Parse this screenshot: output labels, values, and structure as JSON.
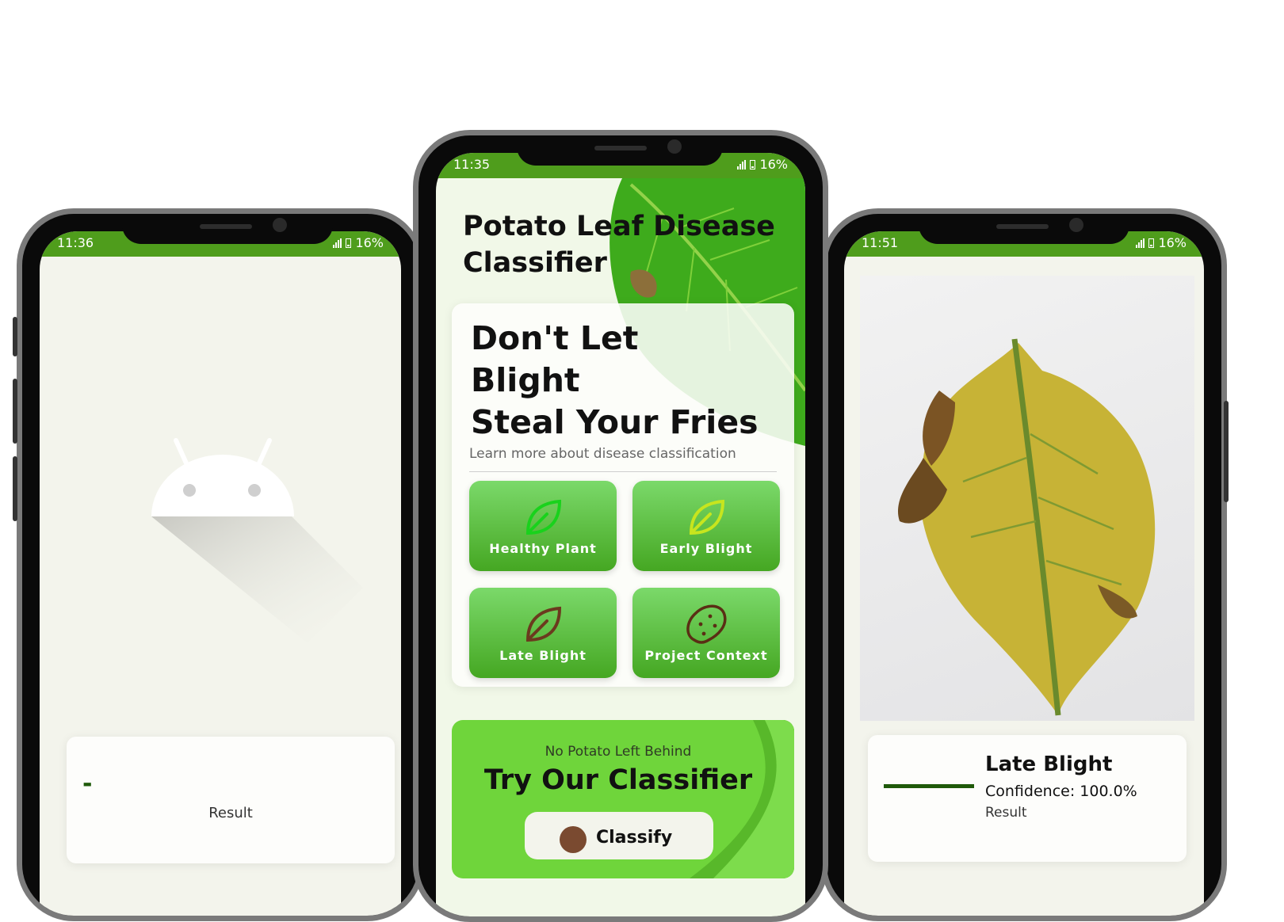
{
  "left_phone": {
    "status": {
      "time": "11:36",
      "battery": "16%"
    },
    "result_card": {
      "dash": "-",
      "result_label": "Result"
    }
  },
  "center_phone": {
    "status": {
      "time": "11:35",
      "battery": "16%"
    },
    "app_title_line1": "Potato Leaf Disease",
    "app_title_line2": "Classifier",
    "hero": {
      "line1": "Don't Let",
      "line2": "Blight",
      "line3": "Steal Your Fries",
      "link": "Learn more about disease classification"
    },
    "tiles": [
      {
        "label": "Healthy Plant",
        "icon": "leaf-icon",
        "color": "#19d21c"
      },
      {
        "label": "Early Blight",
        "icon": "leaf-icon",
        "color": "#c7e51e"
      },
      {
        "label": "Late Blight",
        "icon": "leaf-icon",
        "color": "#6b3a1e"
      },
      {
        "label": "Project Context",
        "icon": "potato-icon",
        "color": "#5a2e14"
      }
    ],
    "promo": {
      "subtitle": "No Potato Left Behind",
      "title": "Try Our Classifier",
      "button_label": "Classify"
    }
  },
  "right_phone": {
    "status": {
      "time": "11:51",
      "battery": "16%"
    },
    "result": {
      "disease": "Late Blight",
      "confidence": "Confidence: 100.0%",
      "result_label": "Result"
    }
  },
  "colors": {
    "brand_green": "#4f9d1c",
    "tile_green": "#55b22c",
    "promo_green": "#6fd53b",
    "bar_dark": "#1f5a0a"
  }
}
